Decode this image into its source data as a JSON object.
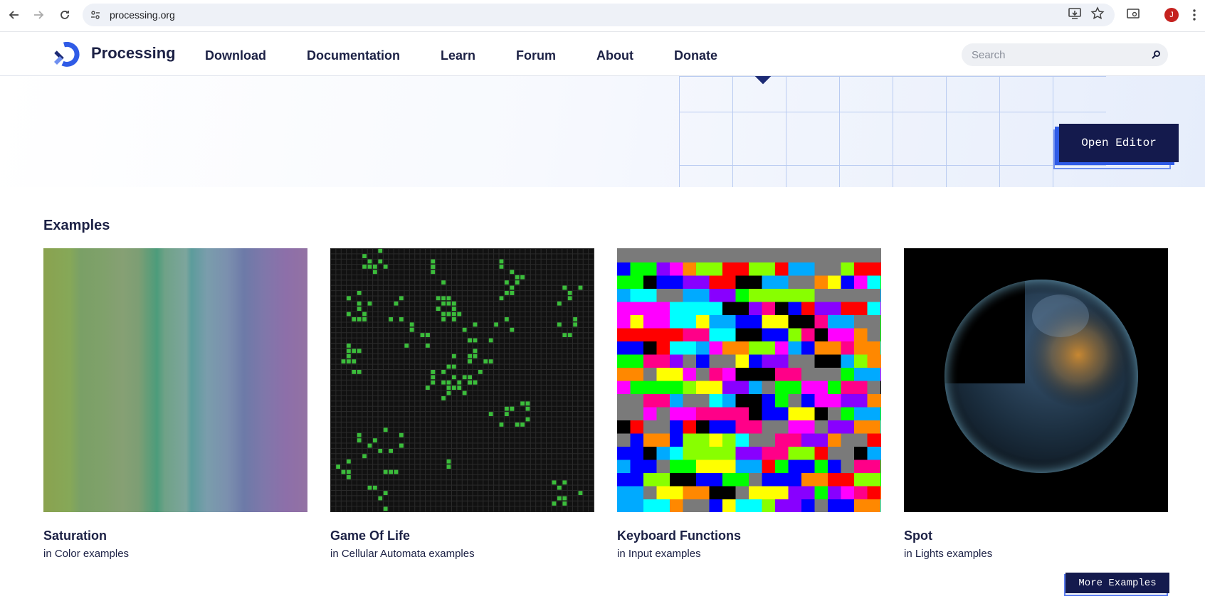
{
  "browser": {
    "url": "processing.org",
    "avatar_letter": "J"
  },
  "site": {
    "brand": "Processing",
    "menu": [
      "Download",
      "Documentation",
      "Learn",
      "Forum",
      "About",
      "Donate"
    ],
    "search_placeholder": "Search"
  },
  "hero": {
    "open_editor_label": "Open Editor"
  },
  "examples": {
    "title": "Examples",
    "cards": [
      {
        "title": "Saturation",
        "subtitle": "in Color examples"
      },
      {
        "title": "Game Of Life",
        "subtitle": "in Cellular Automata examples"
      },
      {
        "title": "Keyboard Functions",
        "subtitle": "in Input examples"
      },
      {
        "title": "Spot",
        "subtitle": "in Lights examples"
      }
    ],
    "more_label": "More Examples"
  },
  "colors": {
    "brand_navy": "#141a4d",
    "accent_blue": "#2f5be6",
    "life_green": "#3bbd3b"
  }
}
